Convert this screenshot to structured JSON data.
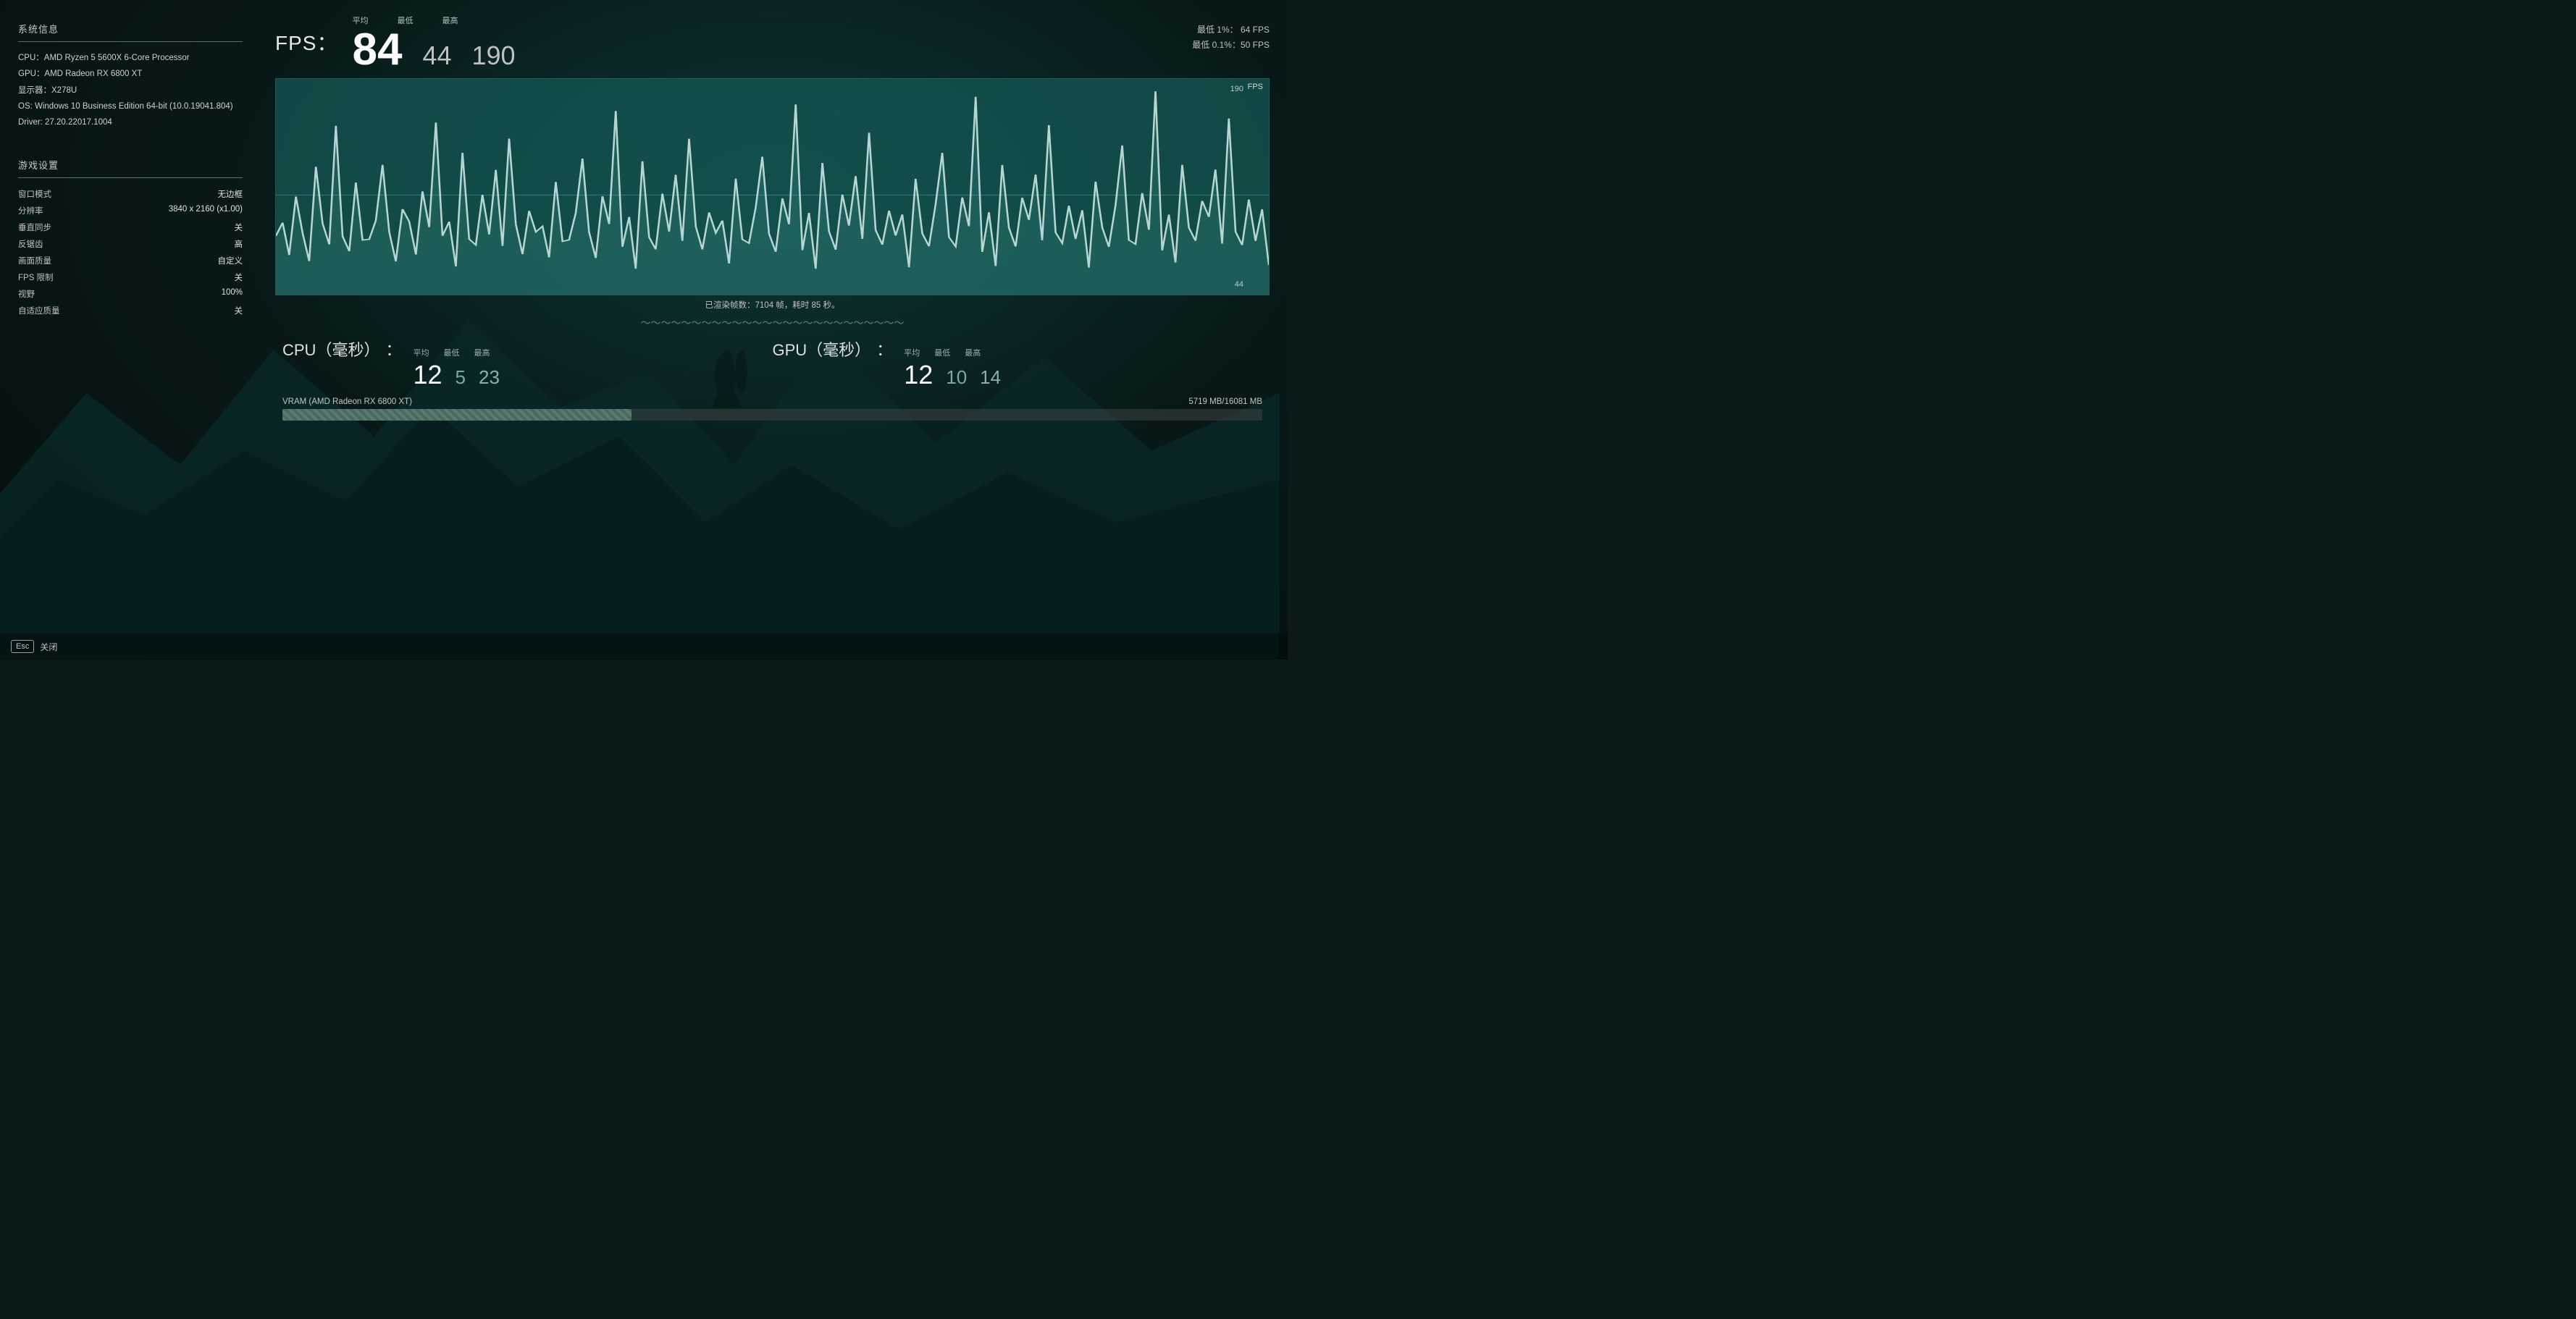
{
  "system_info": {
    "section_title": "系统信息",
    "cpu": "CPU：AMD Ryzen 5 5600X 6-Core Processor",
    "gpu": "GPU：AMD Radeon RX 6800 XT",
    "display": "显示器：X278U",
    "os": "OS: Windows 10 Business Edition 64-bit (10.0.19041.804)",
    "driver": "Driver: 27.20.22017.1004"
  },
  "game_settings": {
    "section_title": "游戏设置",
    "rows": [
      {
        "key": "窗口模式",
        "value": "无边框"
      },
      {
        "key": "分辨率",
        "value": "3840 x 2160 (x1.00)"
      },
      {
        "key": "垂直同步",
        "value": "关"
      },
      {
        "key": "反锯齿",
        "value": "高"
      },
      {
        "key": "画面质量",
        "value": "自定义"
      },
      {
        "key": "FPS 限制",
        "value": "关"
      },
      {
        "key": "视野",
        "value": "100%"
      },
      {
        "key": "自适应质量",
        "value": "关"
      }
    ]
  },
  "fps": {
    "label": "FPS：",
    "avg_label": "平均",
    "min_label": "最低",
    "max_label": "最高",
    "avg": "84",
    "min": "44",
    "max": "190",
    "percentile_1": "最低 1%：  64 FPS",
    "percentile_01": "最低 0.1%：50 FPS",
    "chart_label": "FPS",
    "chart_max": "190",
    "chart_min": "44",
    "rendered_frames": "已渲染帧数：7104 帧，耗时 85 秒。"
  },
  "cpu": {
    "label": "CPU（毫秒）",
    "avg_label": "平均",
    "min_label": "最低",
    "max_label": "最高",
    "avg": "12",
    "min": "5",
    "max": "23"
  },
  "gpu": {
    "label": "GPU（毫秒）",
    "avg_label": "平均",
    "min_label": "最低",
    "max_label": "最高",
    "avg": "12",
    "min": "10",
    "max": "14"
  },
  "vram": {
    "label": "VRAM (AMD Radeon RX 6800 XT)",
    "value": "5719 MB/16081 MB",
    "fill_percent": 35.6
  },
  "esc": {
    "badge": "Esc",
    "label": "关闭"
  },
  "divider_wave": "～～～"
}
